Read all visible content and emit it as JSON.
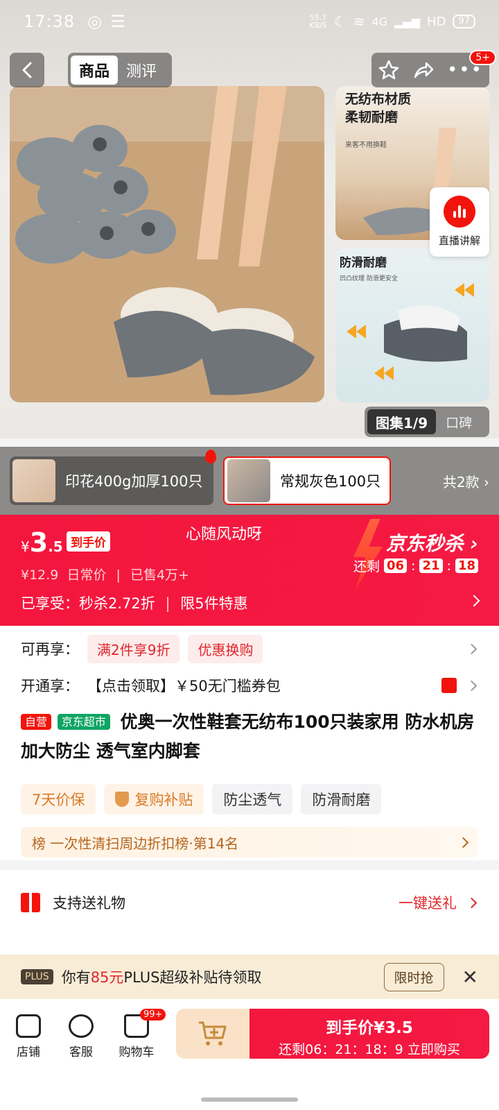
{
  "status": {
    "time": "17:38",
    "speed": "55.7\nKB/S",
    "network": "4G",
    "hd": "HD",
    "battery": "97"
  },
  "header": {
    "tabs": [
      "商品",
      "测评"
    ],
    "cart_count": "5+"
  },
  "gallery": {
    "side1_title_1": "无纺布材质",
    "side1_title_2": "柔韧耐磨",
    "side1_sub": "来客不用换鞋",
    "side2_title": "防滑耐磨",
    "side2_sub": "凹凸纹理 防滑更安全",
    "live_label": "直播讲解",
    "album_label": "图集1/9",
    "review_label": "口碑"
  },
  "variants": {
    "items": [
      {
        "label": "印花400g加厚100只"
      },
      {
        "label": "常规灰色100只"
      }
    ],
    "total": "共2款"
  },
  "price": {
    "currency": "¥",
    "int": "3",
    "dec": ".5",
    "tag": "到手价",
    "slogan": "心随风动呀",
    "original": "¥12.9",
    "original_label": "日常价",
    "sold": "已售4万+",
    "discount_line": "已享受：秒杀2.72折",
    "limit": "限5件特惠",
    "seckill_label": "京东秒杀",
    "remaining_label": "还剩",
    "countdown": [
      "06",
      "21",
      "18"
    ]
  },
  "info": {
    "promo_label": "可再享：",
    "promos": [
      "满2件享9折",
      "优惠换购"
    ],
    "open_label": "开通享：",
    "open_text": "【点击领取】￥50无门槛券包",
    "badge_self": "自营",
    "badge_market": "京东超市",
    "title": "优奥一次性鞋套无纺布100只装家用 防水机房 加大防尘 透气室内脚套",
    "features": [
      "7天价保",
      "复购补贴",
      "防尘透气",
      "防滑耐磨"
    ],
    "rank": "榜 一次性清扫周边折扣榜·第14名"
  },
  "gift": {
    "label": "支持送礼物",
    "action": "一键送礼"
  },
  "plus": {
    "label": "PLUS",
    "text_pre": "你有",
    "amount": "85元",
    "text_post": "PLUS超级补贴待领取",
    "button": "限时抢"
  },
  "bottom": {
    "shop": "店铺",
    "service": "客服",
    "cart": "购物车",
    "cart_badge": "99+",
    "buy_line1": "到手价¥3.5",
    "buy_line2": "还剩06：21：18：9  立即购买"
  }
}
